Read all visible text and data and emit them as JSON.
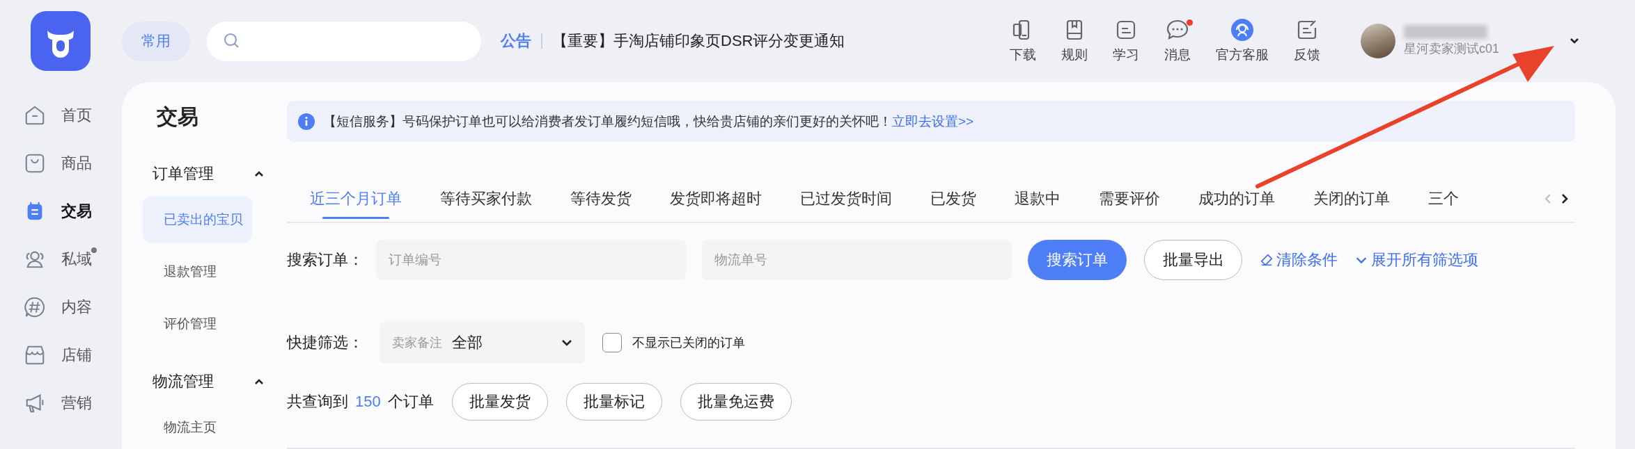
{
  "topbar": {
    "quick_button": "常用",
    "notice": {
      "label": "公告",
      "text": "【重要】手淘店铺印象页DSR评分变更通知"
    },
    "tools": [
      {
        "label": "下载",
        "badge": false
      },
      {
        "label": "规则",
        "badge": false
      },
      {
        "label": "学习",
        "badge": false
      },
      {
        "label": "消息",
        "badge": true
      },
      {
        "label": "官方客服",
        "badge": false
      },
      {
        "label": "反馈",
        "badge": false
      }
    ],
    "user": {
      "name": "星河卖家测试c01"
    }
  },
  "nav": [
    {
      "label": "首页",
      "selected": false,
      "badge": false
    },
    {
      "label": "商品",
      "selected": false,
      "badge": false
    },
    {
      "label": "交易",
      "selected": true,
      "badge": false
    },
    {
      "label": "私域",
      "selected": false,
      "badge": true
    },
    {
      "label": "内容",
      "selected": false,
      "badge": false
    },
    {
      "label": "店铺",
      "selected": false,
      "badge": false
    },
    {
      "label": "营销",
      "selected": false,
      "badge": false
    }
  ],
  "section_title": "交易",
  "subnav": [
    {
      "label": "订单管理",
      "expanded": true,
      "children": [
        {
          "label": "已卖出的宝贝",
          "selected": true
        },
        {
          "label": "退款管理",
          "selected": false
        },
        {
          "label": "评价管理",
          "selected": false
        }
      ]
    },
    {
      "label": "物流管理",
      "expanded": true,
      "children": [
        {
          "label": "物流主页",
          "selected": false
        }
      ]
    }
  ],
  "banner": {
    "text": "【短信服务】号码保护订单也可以给消费者发订单履约短信哦，快给贵店铺的亲们更好的关怀吧！",
    "link": "立即去设置>>"
  },
  "tabs": [
    {
      "label": "近三个月订单",
      "selected": true
    },
    {
      "label": "等待买家付款",
      "selected": false
    },
    {
      "label": "等待发货",
      "selected": false
    },
    {
      "label": "发货即将超时",
      "selected": false
    },
    {
      "label": "已过发货时间",
      "selected": false
    },
    {
      "label": "已发货",
      "selected": false
    },
    {
      "label": "退款中",
      "selected": false
    },
    {
      "label": "需要评价",
      "selected": false
    },
    {
      "label": "成功的订单",
      "selected": false
    },
    {
      "label": "关闭的订单",
      "selected": false
    },
    {
      "label": "三个",
      "selected": false
    }
  ],
  "search": {
    "label": "搜索订单：",
    "fields": [
      {
        "placeholder": "订单编号"
      },
      {
        "placeholder": "物流单号"
      }
    ],
    "buttons": [
      {
        "label": "搜索订单",
        "kind": "primary"
      },
      {
        "label": "批量导出",
        "kind": "outline"
      }
    ],
    "links": [
      {
        "label": "清除条件",
        "kind": "clear"
      },
      {
        "label": "展开所有筛选项",
        "kind": "expand"
      }
    ]
  },
  "quick_filter": {
    "label": "快捷筛选：",
    "select": {
      "prefix": "卖家备注",
      "value": "全部"
    },
    "checkbox": {
      "label": "不显示已关闭的订单",
      "checked": false
    }
  },
  "summary": {
    "prefix": "共查询到",
    "count": "150",
    "suffix": "个订单",
    "buttons": [
      "批量发货",
      "批量标记",
      "批量免运费"
    ]
  }
}
